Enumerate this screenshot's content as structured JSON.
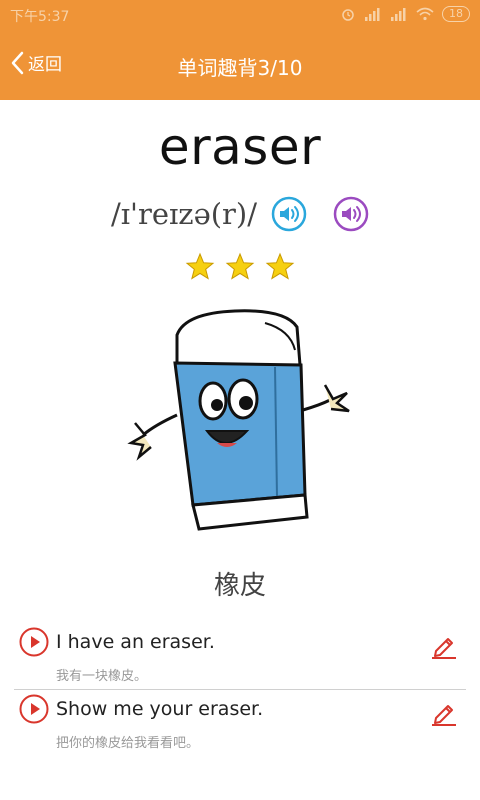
{
  "status": {
    "time": "下午5:37",
    "battery": "18"
  },
  "header": {
    "back_label": "返回",
    "title": "单词趣背3/10"
  },
  "word": {
    "text": "eraser",
    "phonetic": "/ɪ'reɪzə(r)/",
    "stars": 3,
    "meaning": "橡皮"
  },
  "sentences": [
    {
      "en": "I have an eraser.",
      "zh": "我有一块橡皮。"
    },
    {
      "en": "Show me your eraser.",
      "zh": "把你的橡皮给我看看吧。"
    }
  ],
  "colors": {
    "accent": "#ef9437",
    "play_red": "#d9362c",
    "speaker_blue": "#2aa7dc",
    "speaker_purple": "#9b4bc0",
    "star": "#f6d011"
  }
}
